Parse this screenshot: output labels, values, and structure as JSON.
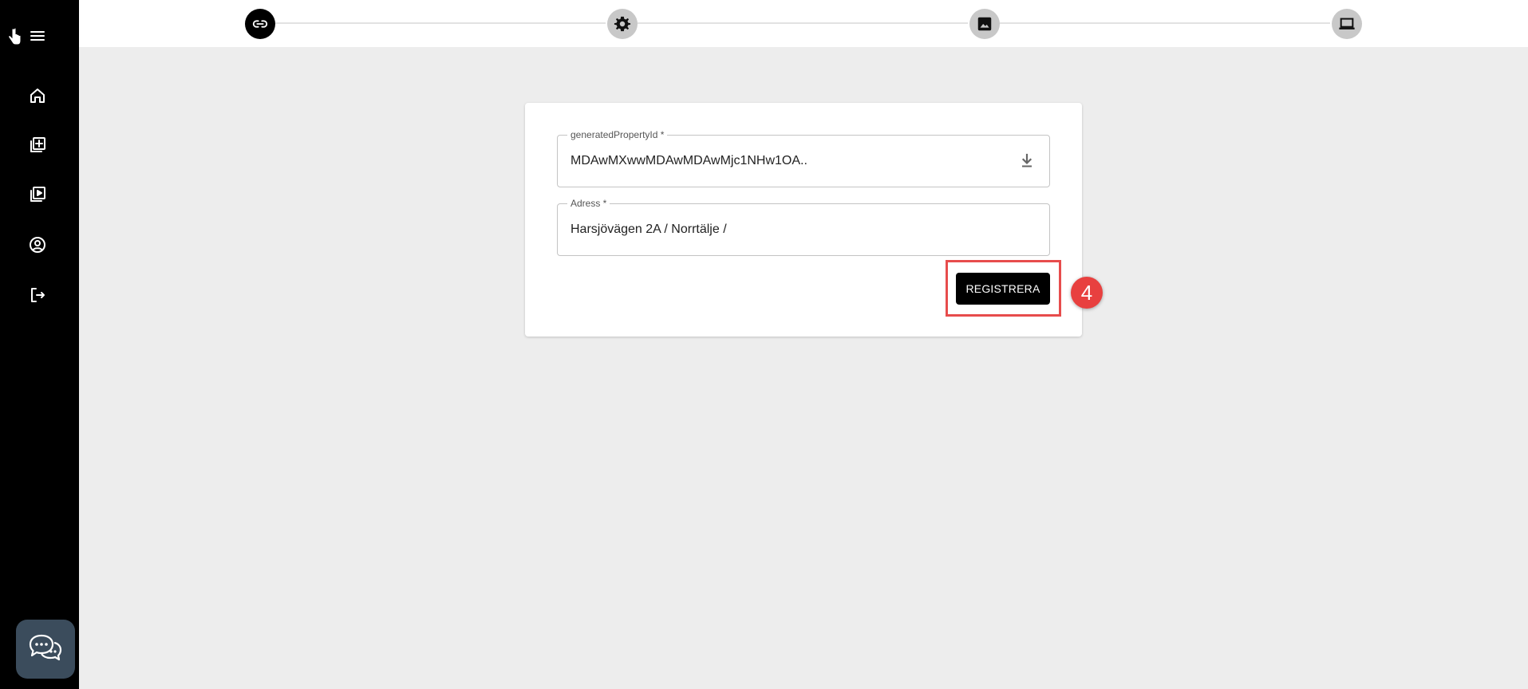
{
  "sidebar": {
    "menu_icon": "hamburger-menu-icon",
    "items": [
      {
        "icon": "home-icon"
      },
      {
        "icon": "add-library-icon"
      },
      {
        "icon": "video-library-icon"
      },
      {
        "icon": "account-circle-icon"
      },
      {
        "icon": "logout-icon"
      }
    ],
    "chat_icon": "chat-bubbles-icon"
  },
  "stepper": {
    "steps": [
      {
        "icon": "link-icon",
        "state": "active"
      },
      {
        "icon": "gear-icon",
        "state": "inactive"
      },
      {
        "icon": "image-icon",
        "state": "inactive"
      },
      {
        "icon": "laptop-icon",
        "state": "inactive"
      }
    ]
  },
  "form": {
    "property_id": {
      "label": "generatedPropertyId *",
      "value": "MDAwMXwwMDAwMDAwMjc1NHw1OA..",
      "icon": "download-icon"
    },
    "address": {
      "label": "Adress *",
      "value": "Harsjövägen 2A / Norrtälje /"
    },
    "register_label": "REGISTRERA"
  },
  "annotation": {
    "step_number": "4",
    "highlight_color": "#e74c4c",
    "badge_color": "#e8403f"
  },
  "colors": {
    "sidebar": "#000000",
    "active_step": "#000000",
    "inactive_step": "#c8c8c8",
    "background": "#ededed",
    "chat_button": "#3b4c5c"
  }
}
